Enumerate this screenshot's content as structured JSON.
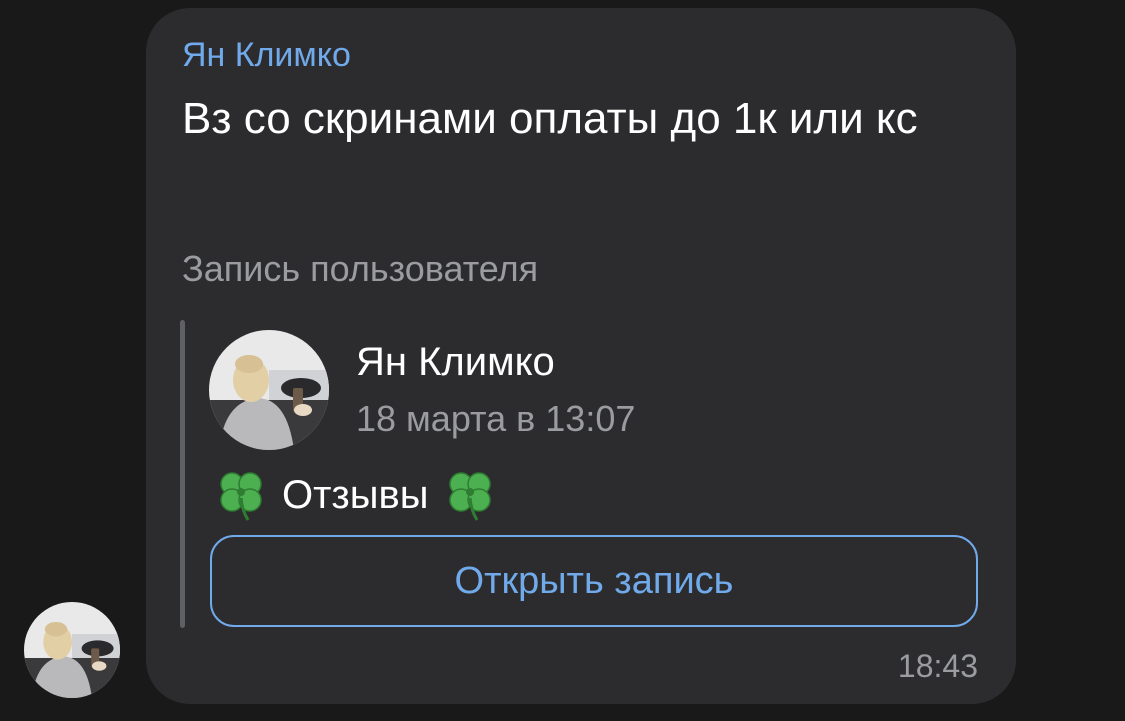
{
  "message": {
    "sender_name": "Ян Климко",
    "text": "Вз со скринами оплаты до 1к или кс",
    "time": "18:43",
    "sender_avatar_icon": "avatar-photo-icon"
  },
  "repost": {
    "label": "Запись пользователя",
    "author_name": "Ян Климко",
    "date": "18 марта в 13:07",
    "title": "Отзывы",
    "title_icon": "clover-icon",
    "open_button_label": "Открыть запись"
  },
  "colors": {
    "background": "#19191a",
    "bubble": "#2c2c2e",
    "accent": "#71aaeb",
    "secondary_text": "#9a9ca0",
    "primary_text": "#ffffff"
  }
}
